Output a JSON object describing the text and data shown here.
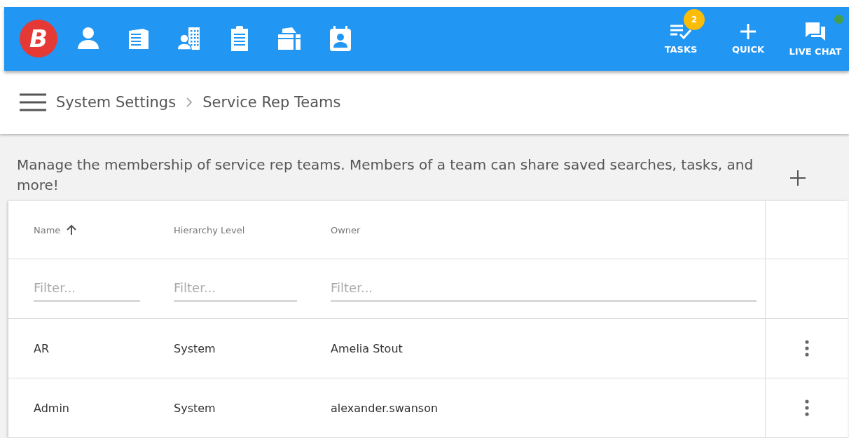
{
  "topbar": {
    "logo": "B",
    "nav_icons": [
      {
        "kind": "person"
      },
      {
        "kind": "building"
      },
      {
        "kind": "support"
      },
      {
        "kind": "clipboard"
      },
      {
        "kind": "briefcase"
      },
      {
        "kind": "contact"
      }
    ],
    "actions": [
      {
        "kind": "tasks",
        "label": "TASKS",
        "badge": "2"
      },
      {
        "kind": "quick",
        "label": "QUICK"
      },
      {
        "kind": "chat",
        "label": "LIVE CHAT",
        "online": true
      }
    ]
  },
  "breadcrumb": [
    "System Settings",
    "Service Rep Teams"
  ],
  "description": "Manage the membership of service rep teams. Members of a team can share saved searches, tasks, and more!",
  "table": {
    "columns": [
      {
        "label": "Name",
        "sorted": true
      },
      {
        "label": "Hierarchy Level",
        "sorted": false
      },
      {
        "label": "Owner",
        "sorted": false
      }
    ],
    "filters": [
      {
        "placeholder": "Filter..."
      },
      {
        "placeholder": "Filter..."
      },
      {
        "placeholder": "Filter..."
      }
    ],
    "rows": [
      [
        "AR",
        "System",
        "Amelia Stout"
      ],
      [
        "Admin",
        "System",
        "alexander.swanson"
      ]
    ]
  }
}
